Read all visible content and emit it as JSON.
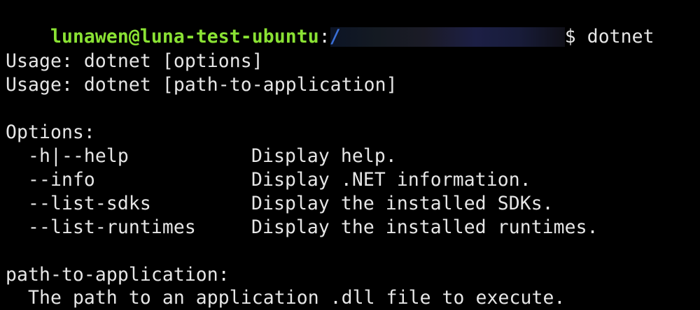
{
  "prompt": {
    "user_host": "lunawen@luna-test-ubuntu",
    "separator": ":",
    "path_visible": "/",
    "dollar": "$",
    "command": "dotnet"
  },
  "output": {
    "usage_lines": [
      "Usage: dotnet [options]",
      "Usage: dotnet [path-to-application]"
    ],
    "options_header": "Options:",
    "options": [
      {
        "flag": "-h|--help",
        "description": "Display help."
      },
      {
        "flag": "--info",
        "description": "Display .NET information."
      },
      {
        "flag": "--list-sdks",
        "description": "Display the installed SDKs."
      },
      {
        "flag": "--list-runtimes",
        "description": "Display the installed runtimes."
      }
    ],
    "path_header": "path-to-application:",
    "path_description": "The path to an application .dll file to execute."
  },
  "colors": {
    "background": "#000000",
    "text": "#e6e6e6",
    "prompt_user": "#8ae234",
    "prompt_path": "#3a6fd8"
  }
}
